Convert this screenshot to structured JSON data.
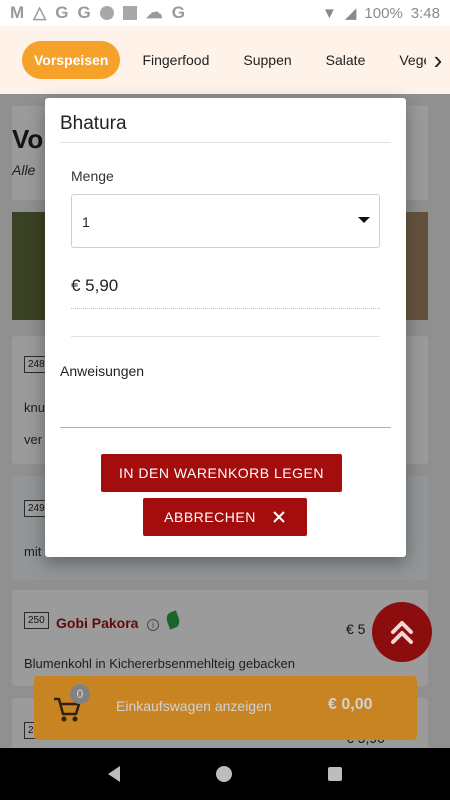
{
  "status_bar": {
    "app_letters": [
      "M",
      "G",
      "G"
    ],
    "last_letter": "G",
    "battery": "100%",
    "time": "3:48"
  },
  "tabs": [
    {
      "label": "Vorspeisen",
      "active": true
    },
    {
      "label": "Fingerfood",
      "active": false
    },
    {
      "label": "Suppen",
      "active": false
    },
    {
      "label": "Salate",
      "active": false
    },
    {
      "label": "Vege",
      "active": false
    }
  ],
  "background": {
    "section_title": "Vo",
    "section_sub": "Alle",
    "section_sub_end": "t",
    "items": [
      {
        "number": "248",
        "desc_1": "knu",
        "desc_2": "ver"
      },
      {
        "number": "249",
        "desc_1": "mit"
      },
      {
        "number": "250",
        "name": "Gobi Pakora",
        "price": "€ 5",
        "desc": "Blumenkohl in Kichererbsenmehlteig gebacken"
      },
      {
        "number": "2",
        "price": "€ 5,90"
      }
    ]
  },
  "dialog": {
    "title": "Bhatura",
    "quantity_label": "Menge",
    "quantity_value": "1",
    "price": "€ 5,90",
    "instructions_label": "Anweisungen",
    "instructions_value": "",
    "add_button": "IN DEN WARENKORB LEGEN",
    "cancel_button": "ABBRECHEN",
    "cancel_icon": "close-icon"
  },
  "cart": {
    "count": "0",
    "label": "Einkaufswagen anzeigen",
    "total": "€ 0,00"
  },
  "colors": {
    "accent": "#f5a12a",
    "primary": "#a30d0d",
    "tab_bar_bg": "#fff2e8"
  }
}
